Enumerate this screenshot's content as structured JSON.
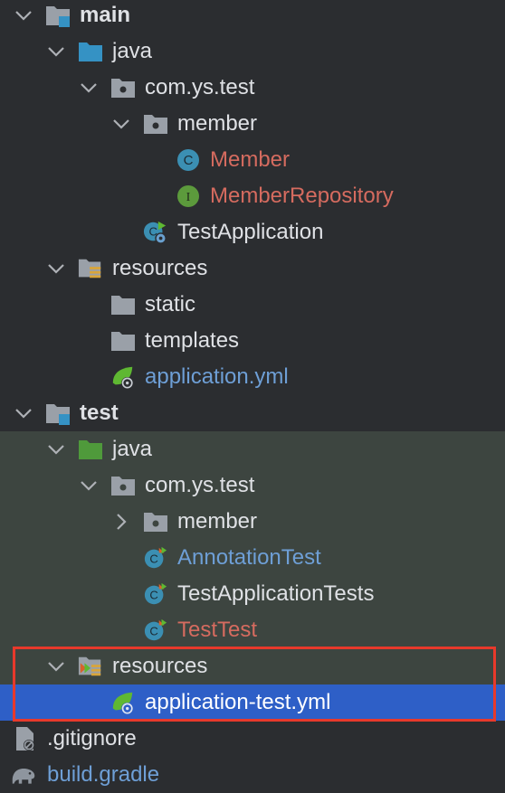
{
  "tree": {
    "main": {
      "label": "main"
    },
    "main_java": {
      "label": "java"
    },
    "main_pkg": {
      "label": "com.ys.test"
    },
    "main_member": {
      "label": "member"
    },
    "member_class": {
      "label": "Member"
    },
    "member_repo": {
      "label": "MemberRepository"
    },
    "test_app": {
      "label": "TestApplication"
    },
    "main_resources": {
      "label": "resources"
    },
    "static_dir": {
      "label": "static"
    },
    "templates_dir": {
      "label": "templates"
    },
    "app_yml": {
      "label": "application.yml"
    },
    "test": {
      "label": "test"
    },
    "test_java": {
      "label": "java"
    },
    "test_pkg": {
      "label": "com.ys.test"
    },
    "test_member": {
      "label": "member"
    },
    "annotation_test": {
      "label": "AnnotationTest"
    },
    "test_app_tests": {
      "label": "TestApplicationTests"
    },
    "test_test": {
      "label": "TestTest"
    },
    "test_resources": {
      "label": "resources"
    },
    "app_test_yml": {
      "label": "application-test.yml"
    },
    "gitignore": {
      "label": ".gitignore"
    },
    "build_gradle": {
      "label": "build.gradle"
    }
  },
  "colors": {
    "background": "#2b2d30",
    "test_section_bg": "#3d4540",
    "selection": "#2e5fc7",
    "modified_text": "#d56b5f",
    "new_text": "#6e9fd6",
    "highlight_border": "#e8392b"
  },
  "icons": {
    "folder_module": "module-folder-icon",
    "folder_source": "source-folder-icon",
    "folder_test_source": "test-source-folder-icon",
    "folder_package": "package-icon",
    "folder_resources": "resources-folder-icon",
    "folder_plain": "folder-icon",
    "class": "class-icon",
    "interface": "interface-icon",
    "spring_app": "spring-boot-app-icon",
    "spring_yml": "spring-yml-icon",
    "test_class": "test-class-icon",
    "gitignore": "gitignore-icon",
    "gradle": "gradle-elephant-icon"
  }
}
